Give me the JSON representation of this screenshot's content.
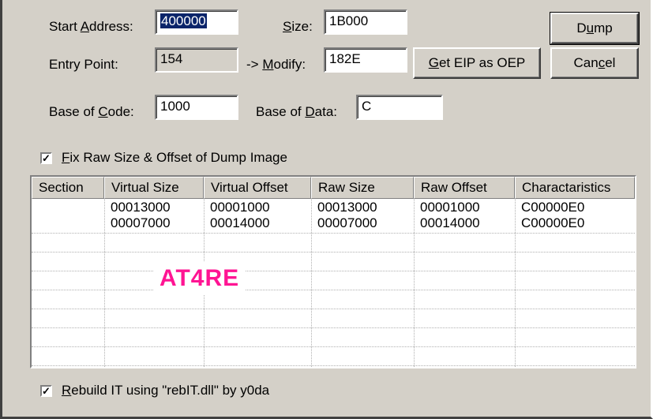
{
  "form": {
    "start_address": {
      "label_pre": "Start ",
      "label_u": "A",
      "label_post": "ddress:",
      "value": "400000"
    },
    "size": {
      "label_pre": "",
      "label_u": "S",
      "label_post": "ize:",
      "value": "1B000"
    },
    "entry_point": {
      "label": "Entry Point:",
      "value": "154"
    },
    "modify": {
      "label_pre": "-> ",
      "label_u": "M",
      "label_post": "odify:",
      "value": "182E"
    },
    "base_of_code": {
      "label_pre": "Base of ",
      "label_u": "C",
      "label_post": "ode:",
      "value": "1000"
    },
    "base_of_data": {
      "label_pre": "Base of ",
      "label_u": "D",
      "label_post": "ata:",
      "value": "C"
    }
  },
  "buttons": {
    "dump": {
      "pre": "D",
      "u": "u",
      "post": "mp"
    },
    "cancel": {
      "pre": "Can",
      "u": "c",
      "post": "el"
    },
    "get_eip": {
      "pre": "",
      "u": "G",
      "post": "et EIP as OEP"
    }
  },
  "options": {
    "fix_raw": {
      "checked": "✓",
      "pre": "",
      "u": "F",
      "post": "ix Raw Size & Offset of Dump Image"
    },
    "rebuild_it": {
      "checked": "✓",
      "pre": "",
      "u": "R",
      "post": "ebuild IT using \"rebIT.dll\" by y0da"
    }
  },
  "table": {
    "columns": [
      "Section",
      "Virtual Size",
      "Virtual Offset",
      "Raw Size",
      "Raw Offset",
      "Charactaristics"
    ],
    "rows": [
      [
        "",
        "00013000",
        "00001000",
        "00013000",
        "00001000",
        "C00000E0"
      ],
      [
        "",
        "00007000",
        "00014000",
        "00007000",
        "00014000",
        "C00000E0"
      ]
    ]
  },
  "watermark": "AT4RE"
}
